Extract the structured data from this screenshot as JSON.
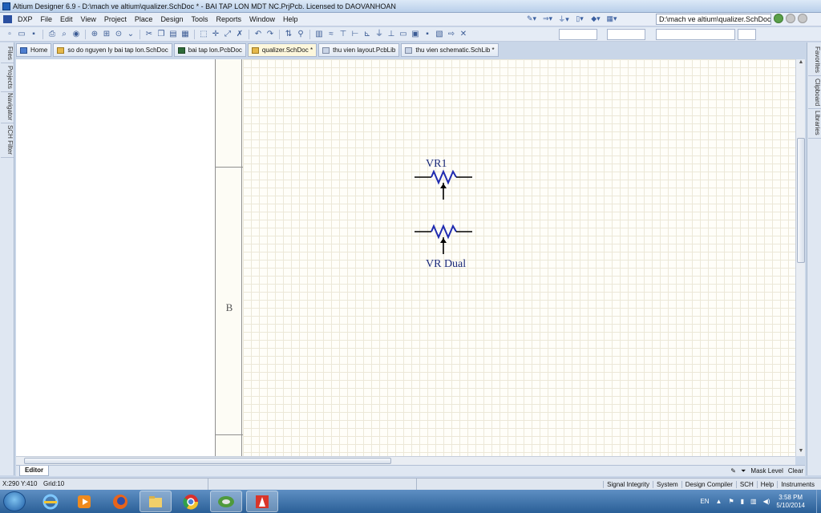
{
  "window": {
    "title": "Altium Designer 6.9 - D:\\mach ve altium\\qualizer.SchDoc * - BAI TAP LON MDT NC.PrjPcb. Licensed to DAOVANHOAN"
  },
  "menu": {
    "items": [
      "DXP",
      "File",
      "Edit",
      "View",
      "Project",
      "Place",
      "Design",
      "Tools",
      "Reports",
      "Window",
      "Help"
    ],
    "path_value": "D:\\mach ve altium\\qualizer.SchDoc"
  },
  "tabs": [
    {
      "label": "Home",
      "icon": "home-icon"
    },
    {
      "label": "so do nguyen ly bai tap lon.SchDoc",
      "icon": "schematic-doc-icon"
    },
    {
      "label": "bai tap lon.PcbDoc",
      "icon": "pcb-doc-icon"
    },
    {
      "label": "qualizer.SchDoc *",
      "icon": "schematic-doc-icon",
      "active": true
    },
    {
      "label": "thu vien layout.PcbLib",
      "icon": "pcb-lib-icon"
    },
    {
      "label": "thu vien schematic.SchLib *",
      "icon": "sch-lib-icon"
    }
  ],
  "left_panel": [
    "Files",
    "Projects",
    "Navigator",
    "SCH Filter"
  ],
  "right_panel": [
    "Favorites",
    "Clipboard",
    "Libraries"
  ],
  "sheet": {
    "zone_label": "B",
    "components": [
      {
        "designator": "VR1",
        "type": "potentiometer"
      },
      {
        "designator": "VR Dual",
        "type": "potentiometer"
      }
    ],
    "colors": {
      "component": "#1f2bb0",
      "pin": "#000000",
      "label": "#1b2a7a",
      "grid": "#ece8d8",
      "paper": "#fffef9"
    }
  },
  "editor": {
    "tab": "Editor",
    "right_items": [
      "Mask Level",
      "Clear"
    ]
  },
  "status": {
    "coords": "X:290 Y:410",
    "grid": "Grid:10",
    "links": [
      "Signal Integrity",
      "System",
      "Design Compiler",
      "SCH",
      "Help",
      "Instruments"
    ]
  },
  "taskbar": {
    "apps": [
      "internet-explorer-icon",
      "media-player-icon",
      "firefox-icon",
      "file-explorer-icon",
      "chrome-icon",
      "altium-icon",
      "office-icon"
    ],
    "language": "EN",
    "time": "3:58 PM",
    "date": "5/10/2014"
  }
}
